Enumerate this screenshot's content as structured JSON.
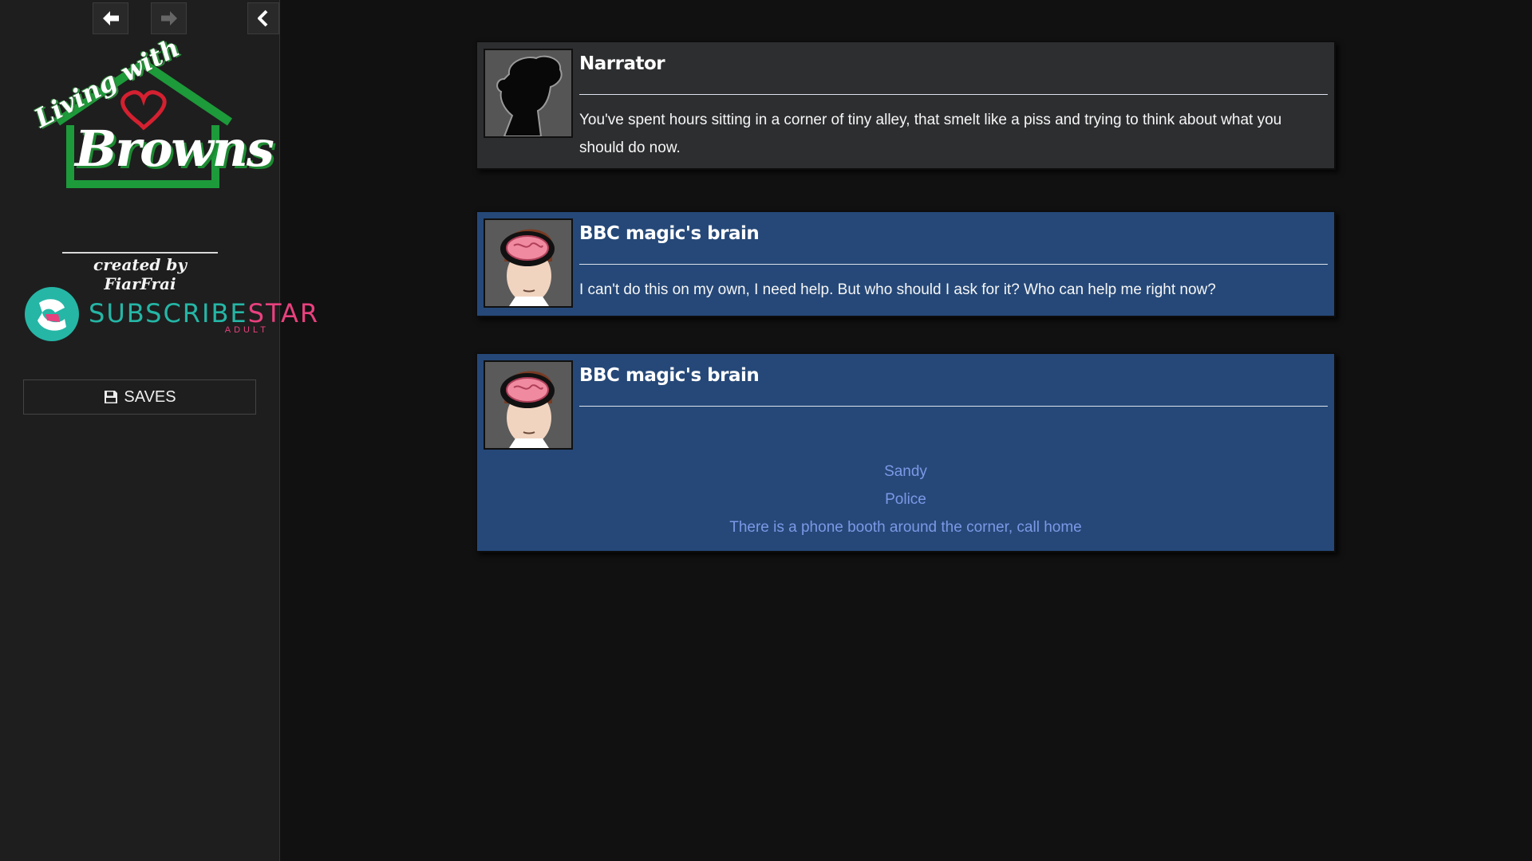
{
  "sidebar": {
    "nav": {
      "back_icon": "arrow-left-icon",
      "forward_icon": "arrow-right-icon",
      "collapse_icon": "chevron-left-icon"
    },
    "logo": {
      "script_text": "Living with",
      "main_word": "Browns",
      "colors": {
        "house": "#1d9a3a",
        "heart": "#d42030"
      }
    },
    "credit": "created by FiarFrai",
    "subscribestar": {
      "part1": "SUBSCRIBE",
      "part2": "STAR",
      "sub": "ADULT",
      "colors": {
        "teal": "#25b6a6",
        "pink": "#e8417e"
      }
    },
    "saves_label": "SAVES",
    "saves_icon": "floppy-disk-icon"
  },
  "passage": {
    "messages": [
      {
        "speaker": "Narrator",
        "avatar": "silhouette-avatar",
        "text": "You've spent hours sitting in a corner of tiny alley, that smelt like a piss and trying to think about what you should do now."
      },
      {
        "speaker": "BBC magic's brain",
        "avatar": "brain-avatar",
        "text": "I can't do this on my own, I need help. But who should I ask for it? Who can help me right now?"
      },
      {
        "speaker": "BBC magic's brain",
        "avatar": "brain-avatar",
        "choices": [
          "Sandy",
          "Police",
          "There is a phone booth around the corner, call home"
        ]
      }
    ]
  },
  "colors": {
    "background": "#111111",
    "sidebar": "#1e1e1e",
    "narrator_box": "#2d2e30",
    "brain_box": "#254878",
    "link": "#7b98e6"
  }
}
